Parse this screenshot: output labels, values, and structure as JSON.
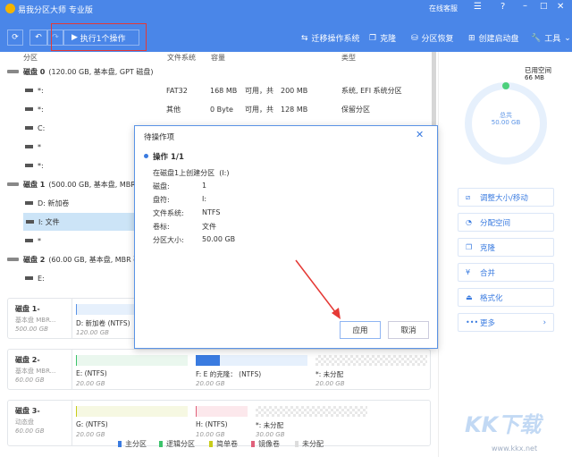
{
  "app": {
    "title": "易我分区大师 专业版",
    "online_service": "在线客服"
  },
  "toolbar": {
    "execute_label": "执行1个操作",
    "migrate_os": "迁移操作系统",
    "clone": "克隆",
    "partition_recovery": "分区恢复",
    "create_boot": "创建启动盘",
    "tools": "工具"
  },
  "table": {
    "headers": [
      "分区",
      "文件系统",
      "容量",
      "类型"
    ],
    "rows": [
      {
        "kind": "disk",
        "name": "磁盘 0",
        "desc": "(120.00 GB, 基本盘, GPT 磁盘)"
      },
      {
        "kind": "part",
        "name": "*:",
        "fs": "FAT32",
        "used": "168 MB",
        "avail": "可用，共",
        "total": "200 MB",
        "type": "系统, EFI 系统分区"
      },
      {
        "kind": "part",
        "name": "*:",
        "fs": "其他",
        "used": "0 Byte",
        "avail": "可用，共",
        "total": "128 MB",
        "type": "保留分区"
      },
      {
        "kind": "part",
        "name": "C:"
      },
      {
        "kind": "part",
        "name": "*"
      },
      {
        "kind": "part",
        "name": "*:"
      },
      {
        "kind": "disk",
        "name": "磁盘 1",
        "desc": "(500.00 GB, 基本盘, MBR 磁"
      },
      {
        "kind": "part",
        "name": "D: 新加卷"
      },
      {
        "kind": "part",
        "name": "I: 文件",
        "selected": true
      },
      {
        "kind": "part",
        "name": "*"
      },
      {
        "kind": "disk",
        "name": "磁盘 2",
        "desc": "(60.00 GB, 基本盘, MBR 磁"
      },
      {
        "kind": "part",
        "name": "E:"
      }
    ]
  },
  "cards": [
    {
      "name": "磁盘 1-",
      "type": "基本盘 MBR...",
      "size": "500.00 GB",
      "parts": [
        {
          "label": "D: 新加卷 (NTFS)",
          "size": "120.00 GB"
        }
      ]
    },
    {
      "name": "磁盘 2-",
      "type": "基本盘 MBR...",
      "size": "60.00 GB",
      "parts": [
        {
          "label": "E:  (NTFS)",
          "size": "20.00 GB"
        },
        {
          "label": "F: E 的克隆：  (NTFS)",
          "size": "20.00 GB"
        },
        {
          "label": "*: 未分配",
          "size": "20.00 GB"
        }
      ]
    },
    {
      "name": "磁盘 3-",
      "type": "动态盘",
      "size": "60.00 GB",
      "parts": [
        {
          "label": "G:  (NTFS)",
          "size": "20.00 GB"
        },
        {
          "label": "H:  (NTFS)",
          "size": "10.00 GB"
        },
        {
          "label": "*: 未分配",
          "size": "30.00 GB"
        }
      ]
    }
  ],
  "legend": [
    {
      "label": "主分区",
      "color": "#3a7be0"
    },
    {
      "label": "逻辑分区",
      "color": "#3cc36b"
    },
    {
      "label": "简单卷",
      "color": "#c8cc1a"
    },
    {
      "label": "镜像卷",
      "color": "#e0607a"
    },
    {
      "label": "未分配",
      "color": "#dddddd"
    }
  ],
  "usage": {
    "used_label": "已用空间",
    "used_value": "66 MB",
    "total_label": "总共",
    "total_value": "50.00 GB",
    "used_fraction": 0.0013
  },
  "actions": [
    "调整大小/移动",
    "分配空间",
    "克隆",
    "合并",
    "格式化",
    "更多"
  ],
  "dialog": {
    "title": "待操作项",
    "op_title": "操作 1/1",
    "op_desc": "在磁盘1上创建分区",
    "op_tag": "(I:)",
    "fields": [
      {
        "k": "磁盘:",
        "v": "1"
      },
      {
        "k": "盘符:",
        "v": "I:"
      },
      {
        "k": "文件系统:",
        "v": "NTFS"
      },
      {
        "k": "卷标:",
        "v": "文件"
      },
      {
        "k": "分区大小:",
        "v": "50.00 GB"
      }
    ],
    "apply": "应用",
    "cancel": "取消"
  },
  "watermark": {
    "logo": "KK下载",
    "url": "www.kkx.net"
  }
}
